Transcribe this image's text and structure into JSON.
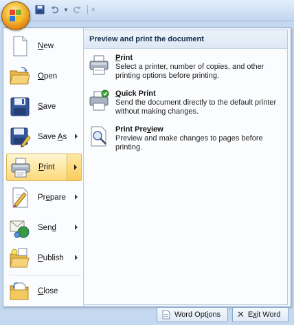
{
  "menu": {
    "items": [
      {
        "label": "New",
        "key": "N",
        "rest": "ew",
        "icon": "new-document-icon",
        "has_arrow": false
      },
      {
        "label": "Open",
        "key": "O",
        "rest": "pen",
        "icon": "open-folder-icon",
        "has_arrow": false
      },
      {
        "label": "Save",
        "key": "S",
        "rest": "ave",
        "icon": "save-disk-icon",
        "has_arrow": false
      },
      {
        "label": "Save As",
        "pre": "Save ",
        "key": "A",
        "rest": "s",
        "icon": "save-as-icon",
        "has_arrow": true
      },
      {
        "label": "Print",
        "key": "P",
        "rest": "rint",
        "icon": "printer-icon",
        "has_arrow": true,
        "highlighted": true
      },
      {
        "label": "Prepare",
        "pre": "Pr",
        "key": "e",
        "rest": "pare",
        "icon": "prepare-icon",
        "has_arrow": true
      },
      {
        "label": "Send",
        "pre": "Sen",
        "key": "d",
        "rest": "",
        "icon": "send-icon",
        "has_arrow": true
      },
      {
        "label": "Publish",
        "key": "P",
        "pre": "",
        "rest": "ublish",
        "icon": "publish-icon",
        "has_arrow": true
      },
      {
        "label": "Close",
        "key": "C",
        "rest": "lose",
        "icon": "close-folder-icon",
        "has_arrow": false
      }
    ]
  },
  "submenu": {
    "header": "Preview and print the document",
    "items": [
      {
        "title_key": "P",
        "title_rest": "rint",
        "title_pre": "",
        "description": "Select a printer, number of copies, and other printing options before printing.",
        "icon": "printer-icon"
      },
      {
        "title_key": "Q",
        "title_rest": "uick Print",
        "title_pre": "",
        "description": "Send the document directly to the default printer without making changes.",
        "icon": "quick-print-icon"
      },
      {
        "title_pre": "Print Pre",
        "title_key": "v",
        "title_rest": "iew",
        "description": "Preview and make changes to pages before printing.",
        "icon": "print-preview-icon"
      }
    ]
  },
  "footer": {
    "options_pre": "Word Opt",
    "options_key": "i",
    "options_rest": "ons",
    "exit_pre": "E",
    "exit_key": "x",
    "exit_rest": "it Word"
  },
  "colors": {
    "highlight": "#fbd87a",
    "panel_border": "#94aed3",
    "header_text": "#15314f"
  }
}
